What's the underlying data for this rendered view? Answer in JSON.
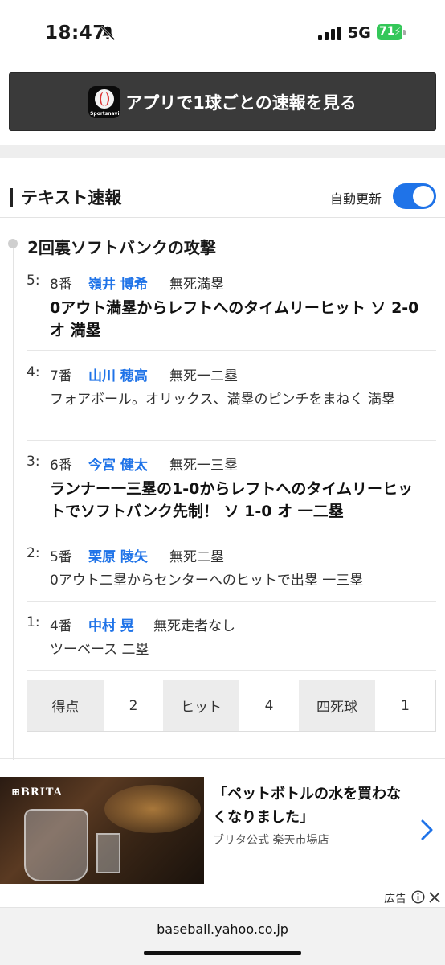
{
  "status_bar": {
    "time": "18:47",
    "network": "5G",
    "battery": "71"
  },
  "app_banner": {
    "icon_label": "Sportsnavi",
    "label": "アプリで1球ごとの速報を見る"
  },
  "section": {
    "title": "テキスト速報",
    "auto_update_label": "自動更新",
    "auto_update_on": true
  },
  "inning": {
    "title": "2回裏ソフトバンクの攻撃",
    "plays": [
      {
        "num": "5",
        "order": "8番",
        "player": "嶺井 博希",
        "situation": "無死満塁",
        "description": "0アウト満塁からレフトへのタイムリーヒット ソ 2-0 オ 満塁",
        "bold": true
      },
      {
        "num": "4",
        "order": "7番",
        "player": "山川 穂高",
        "situation": "無死一二塁",
        "description": "フォアボール。オリックス、満塁のピンチをまねく 満塁",
        "bold": false
      },
      {
        "num": "3",
        "order": "6番",
        "player": "今宮 健太",
        "situation": "無死一三塁",
        "description": "ランナー一三塁の1-0からレフトへのタイムリーヒットでソフトバンク先制！ ソ 1-0 オ 一二塁",
        "bold": true
      },
      {
        "num": "2",
        "order": "5番",
        "player": "栗原 陵矢",
        "situation": "無死二塁",
        "description": "0アウト二塁からセンターへのヒットで出塁 一三塁",
        "bold": false
      },
      {
        "num": "1",
        "order": "4番",
        "player": "中村 晃",
        "situation": "無死走者なし",
        "description": "ツーベース 二塁",
        "bold": false
      }
    ],
    "stats": [
      {
        "label": "得点",
        "value": "2"
      },
      {
        "label": "ヒット",
        "value": "4"
      },
      {
        "label": "四死球",
        "value": "1"
      }
    ]
  },
  "ad": {
    "brand": "BRITA",
    "title": "「ペットボトルの水を買わなくなりました」",
    "sponsor": "ブリタ公式 楽天市場店",
    "label": "広告"
  },
  "browser": {
    "url": "baseball.yahoo.co.jp"
  },
  "colors": {
    "accent": "#1f73e8",
    "banner_bg": "#3a3a3a",
    "battery": "#34c759"
  }
}
